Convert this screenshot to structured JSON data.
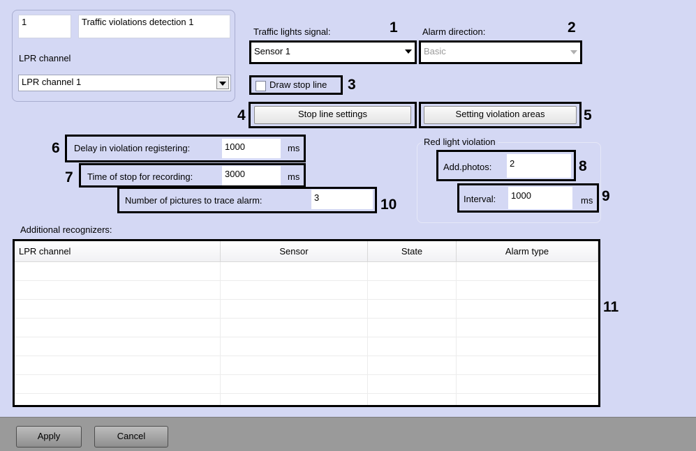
{
  "object": {
    "id": "1",
    "name": "Traffic violations detection 1",
    "lpr_channel_label": "LPR channel",
    "lpr_channel_value": "LPR channel 1"
  },
  "traffic_lights": {
    "label": "Traffic lights signal:",
    "value": "Sensor 1"
  },
  "alarm_direction": {
    "label": "Alarm direction:",
    "value": "Basic"
  },
  "draw_stop_line": {
    "label": "Draw stop line",
    "checked": false
  },
  "buttons": {
    "stop_line_settings": "Stop line settings",
    "violation_areas": "Setting violation areas",
    "apply": "Apply",
    "cancel": "Cancel"
  },
  "delay": {
    "label": "Delay in violation registering:",
    "value": "1000",
    "unit": "ms"
  },
  "stop_time": {
    "label": "Time of stop for recording:",
    "value": "3000",
    "unit": "ms"
  },
  "pictures": {
    "label": "Number of pictures to trace alarm:",
    "value": "3"
  },
  "red_light": {
    "group_label": "Red light violation",
    "photos_label": "Add.photos:",
    "photos_value": "2",
    "interval_label": "Interval:",
    "interval_value": "1000",
    "interval_unit": "ms"
  },
  "recognizers": {
    "label": "Additional recognizers:",
    "columns": [
      "LPR channel",
      "Sensor",
      "State",
      "Alarm type"
    ]
  },
  "markers": [
    "1",
    "2",
    "3",
    "4",
    "5",
    "6",
    "7",
    "8",
    "9",
    "10",
    "11"
  ]
}
